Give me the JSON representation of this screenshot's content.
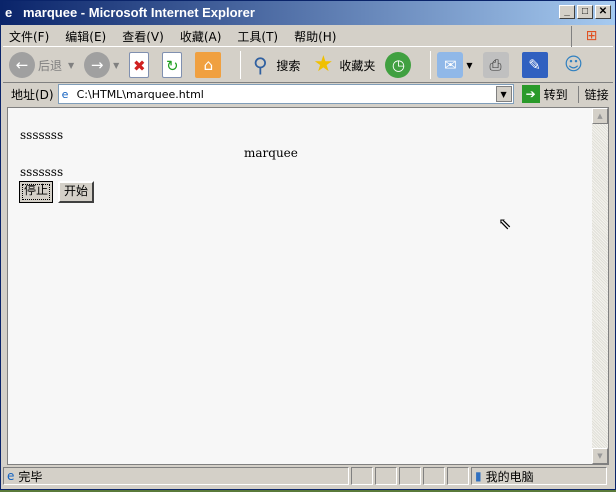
{
  "window": {
    "title": "marquee - Microsoft Internet Explorer"
  },
  "menu": [
    "文件(F)",
    "编辑(E)",
    "查看(V)",
    "收藏(A)",
    "工具(T)",
    "帮助(H)"
  ],
  "toolbar": {
    "back": "后退",
    "search": "搜索",
    "favorites": "收藏夹"
  },
  "address": {
    "label": "地址(D)",
    "value": "C:\\HTML\\marquee.html",
    "go": "转到",
    "links": "链接"
  },
  "page": {
    "line1": "sssssss",
    "marquee": "marquee",
    "line2": "sssssss",
    "stop": "停止",
    "start": "开始"
  },
  "status": {
    "text": "完毕",
    "zone": "我的电脑"
  }
}
